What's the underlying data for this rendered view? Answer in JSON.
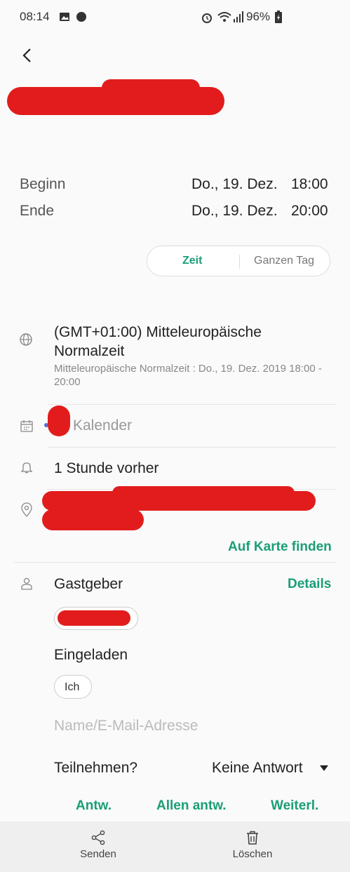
{
  "status_bar": {
    "time": "08:14",
    "battery": "96%"
  },
  "times": {
    "start_label": "Beginn",
    "start_date": "Do., 19. Dez.",
    "start_time": "18:00",
    "end_label": "Ende",
    "end_date": "Do., 19. Dez.",
    "end_time": "20:00"
  },
  "mode_toggle": {
    "time_label": "Zeit",
    "allday_label": "Ganzen Tag"
  },
  "timezone": {
    "name": "(GMT+01:00) Mitteleuropäische Normalzeit",
    "detail": "Mitteleuropäische Normalzeit : Do., 19. Dez. 2019 18:00 - 20:00"
  },
  "calendar": {
    "label": "Kalender"
  },
  "reminder": {
    "label": "1 Stunde vorher"
  },
  "location": {
    "map_link": "Auf Karte finden"
  },
  "host": {
    "label": "Gastgeber",
    "details_link": "Details"
  },
  "invited": {
    "label": "Eingeladen",
    "chip": "Ich",
    "input_placeholder": "Name/E-Mail-Adresse"
  },
  "attend": {
    "label": "Teilnehmen?",
    "value": "Keine Antwort"
  },
  "reply_actions": {
    "reply": "Antw.",
    "reply_all": "Allen antw.",
    "forward": "Weiterl."
  },
  "bottom_bar": {
    "send": "Senden",
    "delete": "Löschen"
  },
  "colors": {
    "accent": "#1a9e77",
    "redaction": "#e21c1c",
    "calendar_dot": "#5b6bd6"
  }
}
